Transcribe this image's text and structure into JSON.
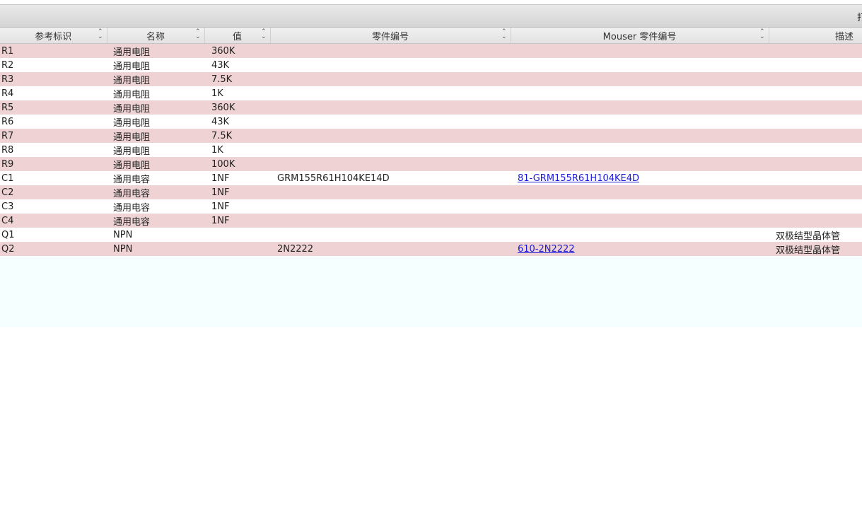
{
  "toolbar": {
    "clipped_text": "打"
  },
  "columns": [
    {
      "label": "参考标识"
    },
    {
      "label": "名称"
    },
    {
      "label": "值"
    },
    {
      "label": "零件编号"
    },
    {
      "label": "Mouser 零件编号"
    },
    {
      "label": "描述"
    }
  ],
  "rows": [
    {
      "ref": "R1",
      "name": "通用电阻",
      "value": "360K",
      "part": "",
      "mouser": "",
      "desc": ""
    },
    {
      "ref": "R2",
      "name": "通用电阻",
      "value": "43K",
      "part": "",
      "mouser": "",
      "desc": ""
    },
    {
      "ref": "R3",
      "name": "通用电阻",
      "value": "7.5K",
      "part": "",
      "mouser": "",
      "desc": ""
    },
    {
      "ref": "R4",
      "name": "通用电阻",
      "value": "1K",
      "part": "",
      "mouser": "",
      "desc": ""
    },
    {
      "ref": "R5",
      "name": "通用电阻",
      "value": "360K",
      "part": "",
      "mouser": "",
      "desc": ""
    },
    {
      "ref": "R6",
      "name": "通用电阻",
      "value": "43K",
      "part": "",
      "mouser": "",
      "desc": ""
    },
    {
      "ref": "R7",
      "name": "通用电阻",
      "value": "7.5K",
      "part": "",
      "mouser": "",
      "desc": ""
    },
    {
      "ref": "R8",
      "name": "通用电阻",
      "value": "1K",
      "part": "",
      "mouser": "",
      "desc": ""
    },
    {
      "ref": "R9",
      "name": "通用电阻",
      "value": "100K",
      "part": "",
      "mouser": "",
      "desc": ""
    },
    {
      "ref": "C1",
      "name": "通用电容",
      "value": "1NF",
      "part": "GRM155R61H104KE14D",
      "mouser": "81-GRM155R61H104KE4D",
      "desc": ""
    },
    {
      "ref": "C2",
      "name": "通用电容",
      "value": "1NF",
      "part": "",
      "mouser": "",
      "desc": ""
    },
    {
      "ref": "C3",
      "name": "通用电容",
      "value": "1NF",
      "part": "",
      "mouser": "",
      "desc": ""
    },
    {
      "ref": "C4",
      "name": "通用电容",
      "value": "1NF",
      "part": "",
      "mouser": "",
      "desc": ""
    },
    {
      "ref": "Q1",
      "name": "NPN",
      "value": "",
      "part": "",
      "mouser": "",
      "desc": "双极结型晶体管"
    },
    {
      "ref": "Q2",
      "name": "NPN",
      "value": "",
      "part": "2N2222",
      "mouser": "610-2N2222",
      "desc": "双极结型晶体管"
    }
  ],
  "colors": {
    "row_odd": "#efd3d4",
    "row_even": "#ffffff",
    "link": "#1a1ad6",
    "empty_area": "#f5ffff"
  }
}
